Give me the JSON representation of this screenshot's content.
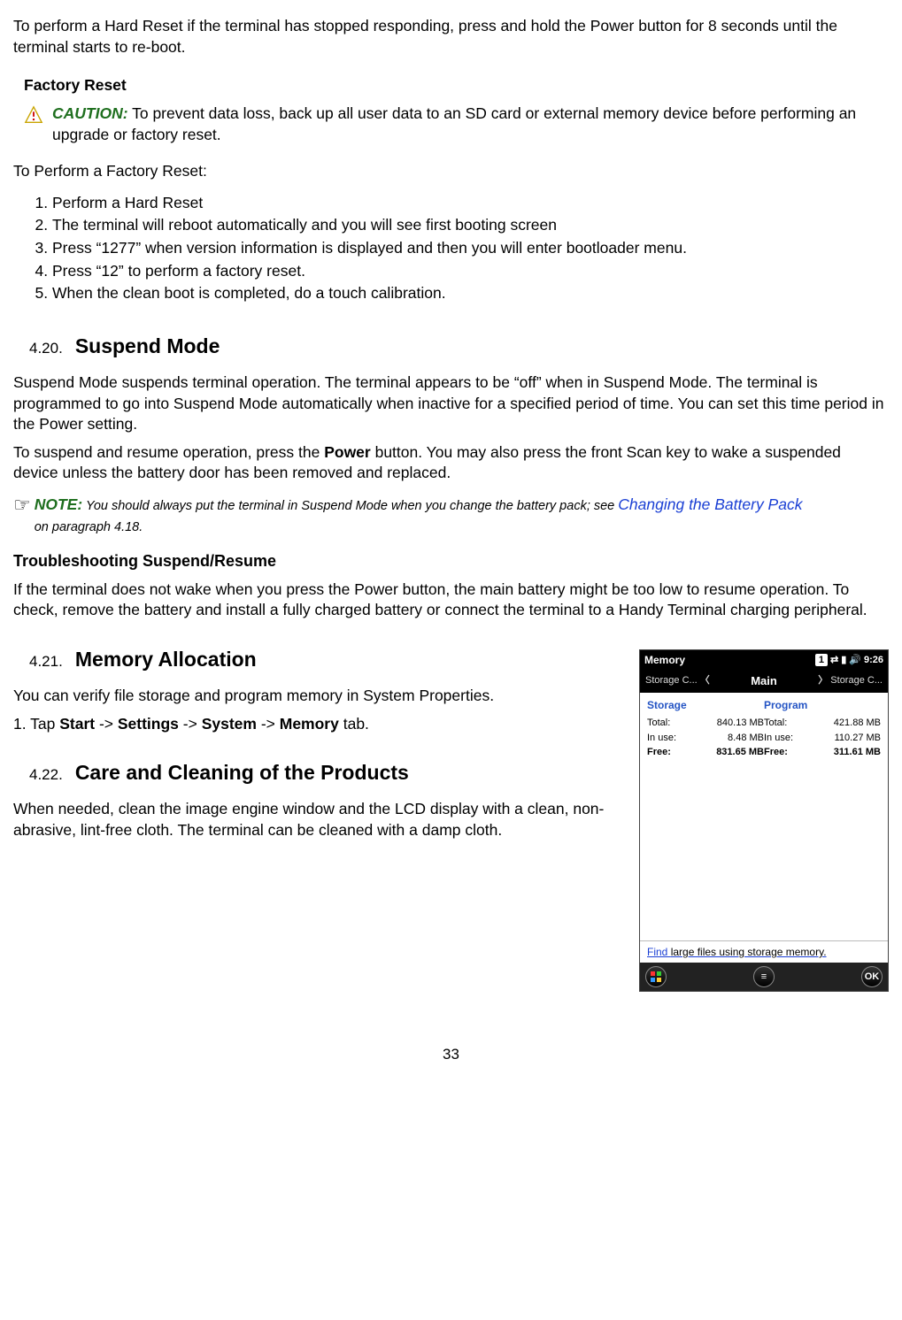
{
  "intro_hard_reset": "To perform a Hard Reset if the terminal has stopped responding, press and hold the Power button for 8 seconds until the terminal starts to re-boot.",
  "factory_reset_heading": "Factory Reset",
  "caution_label": "CAUTION:",
  "caution_text": " To prevent data loss, back up all user data to an SD card or external memory device before performing an upgrade or factory reset.",
  "to_perform": "To Perform a Factory Reset:",
  "steps": {
    "s1": "Perform a Hard Reset",
    "s2": "The terminal will reboot automatically and you will see first booting screen",
    "s3": "Press “1277” when version information is displayed and then you will enter bootloader menu.",
    "s4": "Press “12” to perform a factory reset.",
    "s5": "When the clean boot is completed, do a touch calibration."
  },
  "sec420_num": "4.20.",
  "sec420_title": "Suspend Mode",
  "sec420_p1": "Suspend Mode suspends terminal operation. The terminal appears to be “off” when in Suspend Mode. The terminal is programmed to go into Suspend Mode automatically when inactive for a specified period of time. You can set this time period in the Power setting.",
  "sec420_p2_a": "To suspend and resume operation, press the ",
  "sec420_p2_bold": "Power",
  "sec420_p2_b": " button. You may also press the front Scan key to wake a suspended device unless the battery door has been removed and replaced.",
  "note_label": "NOTE:",
  "note_text_a": " You should always put the terminal in Suspend Mode when you change the battery pack; see ",
  "note_link": "Changing the Battery Pack",
  "note_text_b": " on paragraph 4.18.",
  "troubleshoot_head": "Troubleshooting Suspend/Resume",
  "troubleshoot_text": "If the terminal does not wake when you press the Power button, the main battery might be too low to resume operation. To check, remove the battery and install a fully charged battery or connect the terminal to a Handy Terminal charging peripheral.",
  "sec421_num": "4.21.",
  "sec421_title": "Memory Allocation",
  "sec421_p1": "You can verify file storage and program memory in System Properties.",
  "sec421_p2_a": "1. Tap ",
  "sec421_p2_start": "Start",
  "sec421_p2_arr": " -> ",
  "sec421_p2_settings": "Settings",
  "sec421_p2_system": "System",
  "sec421_p2_memory": "Memory",
  "sec421_p2_tab": " tab.",
  "sec422_num": "4.22.",
  "sec422_title": "Care and Cleaning of the Products",
  "sec422_p1": "When needed, clean the image engine window and the LCD display with a clean, non-abrasive, lint-free cloth. The terminal can be cleaned with a damp cloth.",
  "screenshot": {
    "title": "Memory",
    "time": "9:26",
    "badge": "1",
    "nav_left": "Storage C...",
    "nav_mid": "Main",
    "nav_right": "Storage C...",
    "storage_head": "Storage",
    "program_head": "Program",
    "rows": {
      "total": "Total:",
      "inuse": "In use:",
      "free": "Free:"
    },
    "storage": {
      "total": "840.13 MB",
      "inuse": "8.48 MB",
      "free": "831.65 MB"
    },
    "program": {
      "total": "421.88 MB",
      "inuse": "110.27 MB",
      "free": "311.61 MB"
    },
    "link_a": "Find ",
    "link_b": "large files using storage memory.",
    "ok": "OK"
  },
  "page_number": "33"
}
